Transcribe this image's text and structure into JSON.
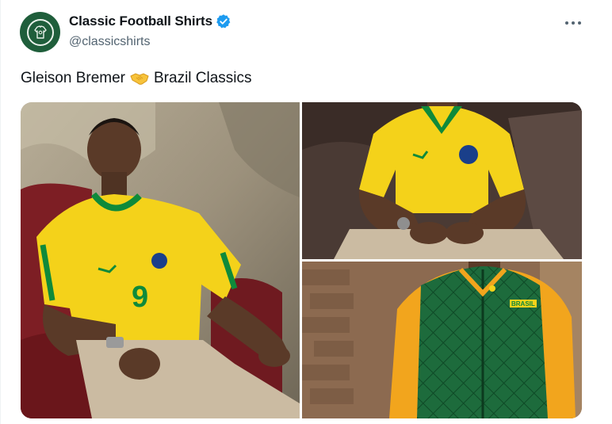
{
  "tweet": {
    "display_name": "Classic Football Shirts",
    "handle": "@classicshirts",
    "verified": true,
    "text_before": "Gleison Bremer",
    "emoji": "handshake-emoji",
    "text_after": "Brazil Classics",
    "more_icon": "more-horizontal-icon"
  },
  "media": {
    "count": 3,
    "photos": [
      {
        "name": "man-in-1998-brazil-home-shirt-number-9",
        "shirt_number": "9"
      },
      {
        "name": "man-in-yellow-brazil-shirt-seated"
      },
      {
        "name": "green-quilted-brazil-jacket-with-yellow-sleeves",
        "badge_text": "BRASIL"
      }
    ]
  },
  "colors": {
    "text": "#0f1419",
    "secondary": "#536471",
    "verified_blue": "#1d9bf0",
    "avatar_green": "#1f5e3b",
    "brazil_yellow": "#f4d21a",
    "brazil_green": "#0f8a3a"
  }
}
